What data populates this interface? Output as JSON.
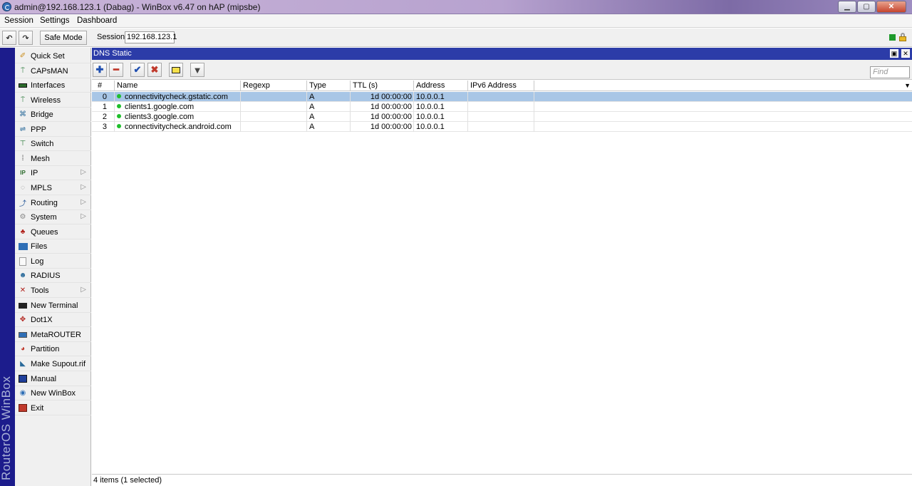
{
  "window": {
    "title": "admin@192.168.123.1 (Dabag) - WinBox v6.47 on hAP (mipsbe)"
  },
  "menubar": {
    "session": "Session",
    "settings": "Settings",
    "dashboard": "Dashboard"
  },
  "toolbar": {
    "safe_mode": "Safe Mode",
    "session_label": "Session:",
    "session_value": "192.168.123.1"
  },
  "brand": "RouterOS WinBox",
  "sidebar": {
    "items": [
      {
        "label": "Quick Set",
        "icon": "magic-wand-icon",
        "submenu": false
      },
      {
        "label": "CAPsMAN",
        "icon": "antenna-icon",
        "submenu": false
      },
      {
        "label": "Interfaces",
        "icon": "interfaces-icon",
        "submenu": false
      },
      {
        "label": "Wireless",
        "icon": "wireless-icon",
        "submenu": false
      },
      {
        "label": "Bridge",
        "icon": "bridge-icon",
        "submenu": false
      },
      {
        "label": "PPP",
        "icon": "ppp-icon",
        "submenu": false
      },
      {
        "label": "Switch",
        "icon": "switch-icon",
        "submenu": false
      },
      {
        "label": "Mesh",
        "icon": "mesh-icon",
        "submenu": false
      },
      {
        "label": "IP",
        "icon": "ip-icon",
        "submenu": true
      },
      {
        "label": "MPLS",
        "icon": "mpls-icon",
        "submenu": true
      },
      {
        "label": "Routing",
        "icon": "routing-icon",
        "submenu": true
      },
      {
        "label": "System",
        "icon": "system-gear-icon",
        "submenu": true
      },
      {
        "label": "Queues",
        "icon": "queues-icon",
        "submenu": false
      },
      {
        "label": "Files",
        "icon": "folder-icon",
        "submenu": false
      },
      {
        "label": "Log",
        "icon": "log-icon",
        "submenu": false
      },
      {
        "label": "RADIUS",
        "icon": "radius-users-icon",
        "submenu": false
      },
      {
        "label": "Tools",
        "icon": "tools-icon",
        "submenu": true
      },
      {
        "label": "New Terminal",
        "icon": "terminal-icon",
        "submenu": false
      },
      {
        "label": "Dot1X",
        "icon": "dot1x-icon",
        "submenu": false
      },
      {
        "label": "MetaROUTER",
        "icon": "metarouter-icon",
        "submenu": false
      },
      {
        "label": "Partition",
        "icon": "partition-pie-icon",
        "submenu": false
      },
      {
        "label": "Make Supout.rif",
        "icon": "supout-icon",
        "submenu": false
      },
      {
        "label": "Manual",
        "icon": "manual-book-icon",
        "submenu": false
      },
      {
        "label": "New WinBox",
        "icon": "winbox-globe-icon",
        "submenu": false
      },
      {
        "label": "Exit",
        "icon": "exit-icon",
        "submenu": false
      }
    ]
  },
  "panel": {
    "title": "DNS Static",
    "find_placeholder": "Find",
    "columns": [
      "#",
      "Name",
      "Regexp",
      "Type",
      "TTL (s)",
      "Address",
      "IPv6 Address"
    ],
    "rows": [
      {
        "num": "0",
        "name": "connectivitycheck.gstatic.com",
        "regexp": "",
        "type": "A",
        "ttl": "1d 00:00:00",
        "address": "10.0.0.1",
        "ipv6": "",
        "selected": true
      },
      {
        "num": "1",
        "name": "clients1.google.com",
        "regexp": "",
        "type": "A",
        "ttl": "1d 00:00:00",
        "address": "10.0.0.1",
        "ipv6": "",
        "selected": false
      },
      {
        "num": "2",
        "name": "clients3.google.com",
        "regexp": "",
        "type": "A",
        "ttl": "1d 00:00:00",
        "address": "10.0.0.1",
        "ipv6": "",
        "selected": false
      },
      {
        "num": "3",
        "name": "connectivitycheck.android.com",
        "regexp": "",
        "type": "A",
        "ttl": "1d 00:00:00",
        "address": "10.0.0.1",
        "ipv6": "",
        "selected": false
      }
    ],
    "status": "4 items (1 selected)"
  },
  "colors": {
    "panel_title_bg": "#2c3ca8",
    "brand_bg": "#1c1c8c",
    "selected_row": "#a8c6e6",
    "enabled_dot": "#1fbf2c"
  }
}
